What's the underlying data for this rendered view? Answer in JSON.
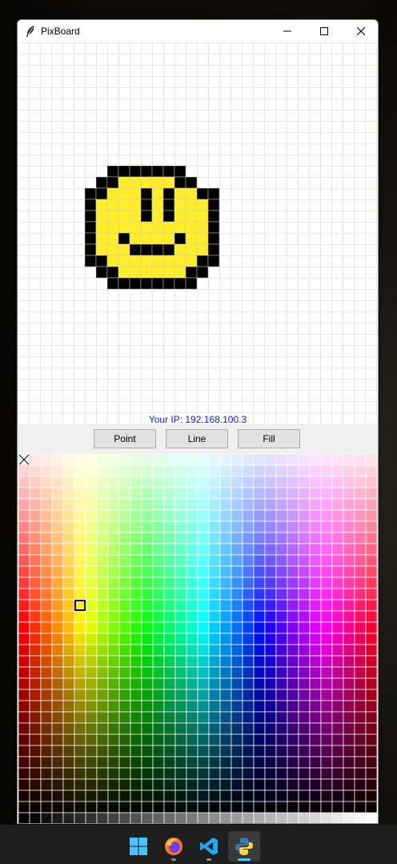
{
  "window": {
    "title": "PixBoard",
    "icon": "feather-icon",
    "controls": [
      "minimize-icon",
      "maximize-icon",
      "close-icon"
    ]
  },
  "canvas": {
    "grid_color": "#e6e6e6",
    "cell_count": [
      32,
      34
    ],
    "palette_colors": {
      "black": "#000000",
      "yellow": "#ffed2b"
    },
    "drawing": [
      "..........",
      "..OOOOOOO...",
      ".OOYYYYYOO..",
      "OOYYYOYOYYOO",
      "OYYYYOYOYYYO",
      "OYYYYOYOYYYO",
      "OYYYYYYYYYYO",
      "OYYOYYYYOYYO",
      "OYYYOOOOYYYO",
      "OOYYYYYYYYOO",
      ".OOYYYYYYOO.",
      "..OOOOOOOO.."
    ]
  },
  "status": {
    "ip_label": "Your IP: 192.168.100.3"
  },
  "tools": {
    "point_label": "Point",
    "line_label": "Line",
    "fill_label": "Fill"
  },
  "palette": {
    "columns": 32,
    "rows": 33,
    "selected_color": "#ffe800",
    "selection_color": "#00008b",
    "eraser_icon": "eraser-cross-icon"
  },
  "taskbar": {
    "items": [
      {
        "name": "windows-start-icon",
        "running": false
      },
      {
        "name": "firefox-icon",
        "running": true
      },
      {
        "name": "vscode-icon",
        "running": true
      },
      {
        "name": "python-icon",
        "running": true,
        "active": true
      }
    ]
  }
}
